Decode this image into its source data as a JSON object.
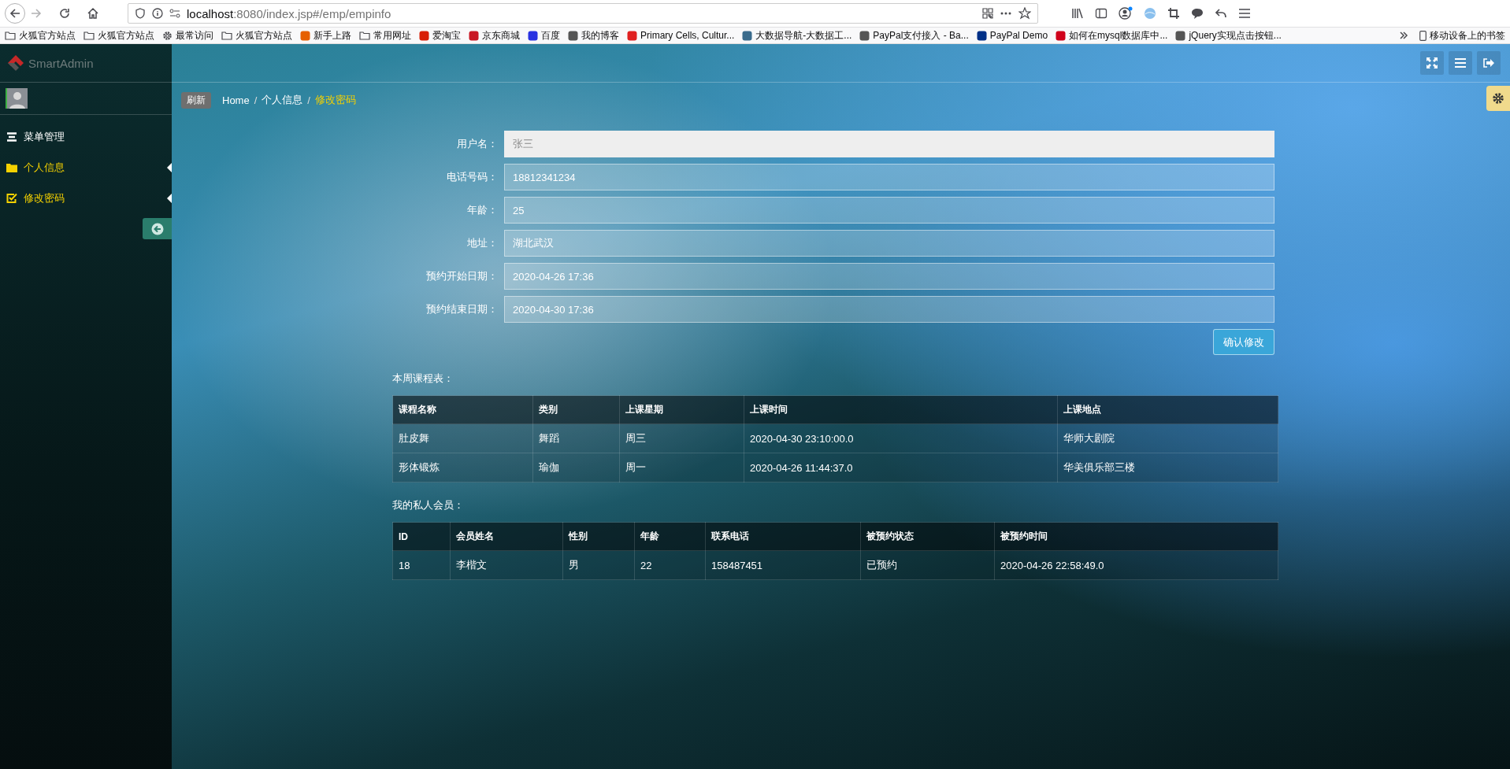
{
  "browser": {
    "url_host": "localhost",
    "url_path": ":8080/index.jsp#/emp/empinfo",
    "bookmarks": [
      {
        "label": "火狐官方站点",
        "kind": "folder"
      },
      {
        "label": "火狐官方站点",
        "kind": "folder"
      },
      {
        "label": "最常访问",
        "kind": "gear"
      },
      {
        "label": "火狐官方站点",
        "kind": "folder"
      },
      {
        "label": "新手上路",
        "kind": "site",
        "color": "#e66000"
      },
      {
        "label": "常用网址",
        "kind": "folder"
      },
      {
        "label": "爱淘宝",
        "kind": "site",
        "color": "#d81e06"
      },
      {
        "label": "京东商城",
        "kind": "site",
        "color": "#c91623"
      },
      {
        "label": "百度",
        "kind": "site",
        "color": "#2932e1"
      },
      {
        "label": "我的博客",
        "kind": "site",
        "color": "#555555"
      },
      {
        "label": "Primary Cells, Cultur...",
        "kind": "site",
        "color": "#e02020"
      },
      {
        "label": "大数据导航-大数据工...",
        "kind": "site",
        "color": "#3a6b8c"
      },
      {
        "label": "PayPal支付接入 - Ba...",
        "kind": "site",
        "color": "#555555"
      },
      {
        "label": "PayPal Demo",
        "kind": "site",
        "color": "#003087"
      },
      {
        "label": "如何在mysql数据库中...",
        "kind": "site",
        "color": "#d0021b"
      },
      {
        "label": "jQuery实现点击按钮...",
        "kind": "site",
        "color": "#555555"
      }
    ],
    "mobile_bookmarks": "移动设备上的书签"
  },
  "sidebar": {
    "logo": "SmartAdmin",
    "menu": [
      {
        "label": "菜单管理",
        "kind": "list",
        "selected": false
      },
      {
        "label": "个人信息",
        "kind": "folder",
        "selected": true
      },
      {
        "label": "修改密码",
        "kind": "check",
        "selected": true
      }
    ]
  },
  "breadcrumb": {
    "refresh": "刷新",
    "separator": "/",
    "items": [
      {
        "label": "Home",
        "selected": false
      },
      {
        "label": "个人信息",
        "selected": false
      },
      {
        "label": "修改密码",
        "selected": true
      }
    ]
  },
  "form": {
    "fields": [
      {
        "label": "用户名：",
        "value": "张三",
        "disabled": true
      },
      {
        "label": "电话号码：",
        "value": "18812341234",
        "disabled": false
      },
      {
        "label": "年龄：",
        "value": "25",
        "disabled": false
      },
      {
        "label": "地址：",
        "value": "湖北武汉",
        "disabled": false
      },
      {
        "label": "预约开始日期：",
        "value": "2020-04-26 17:36",
        "disabled": false
      },
      {
        "label": "预约结束日期：",
        "value": "2020-04-30 17:36",
        "disabled": false
      }
    ],
    "submit": "确认修改"
  },
  "course_table": {
    "title": "本周课程表：",
    "columns": [
      "课程名称",
      "类别",
      "上课星期",
      "上课时间",
      "上课地点"
    ],
    "rows": [
      [
        "肚皮舞",
        "舞蹈",
        "周三",
        "2020-04-30 23:10:00.0",
        "华师大剧院"
      ],
      [
        "形体锻炼",
        "瑜伽",
        "周一",
        "2020-04-26 11:44:37.0",
        "华美俱乐部三楼"
      ]
    ]
  },
  "member_table": {
    "title": "我的私人会员：",
    "columns": [
      "ID",
      "会员姓名",
      "性别",
      "年龄",
      "联系电话",
      "被预约状态",
      "被预约时间"
    ],
    "rows": [
      [
        "18",
        "李楷文",
        "男",
        "22",
        "158487451",
        "已预约",
        "2020-04-26 22:58:49.0"
      ]
    ]
  }
}
